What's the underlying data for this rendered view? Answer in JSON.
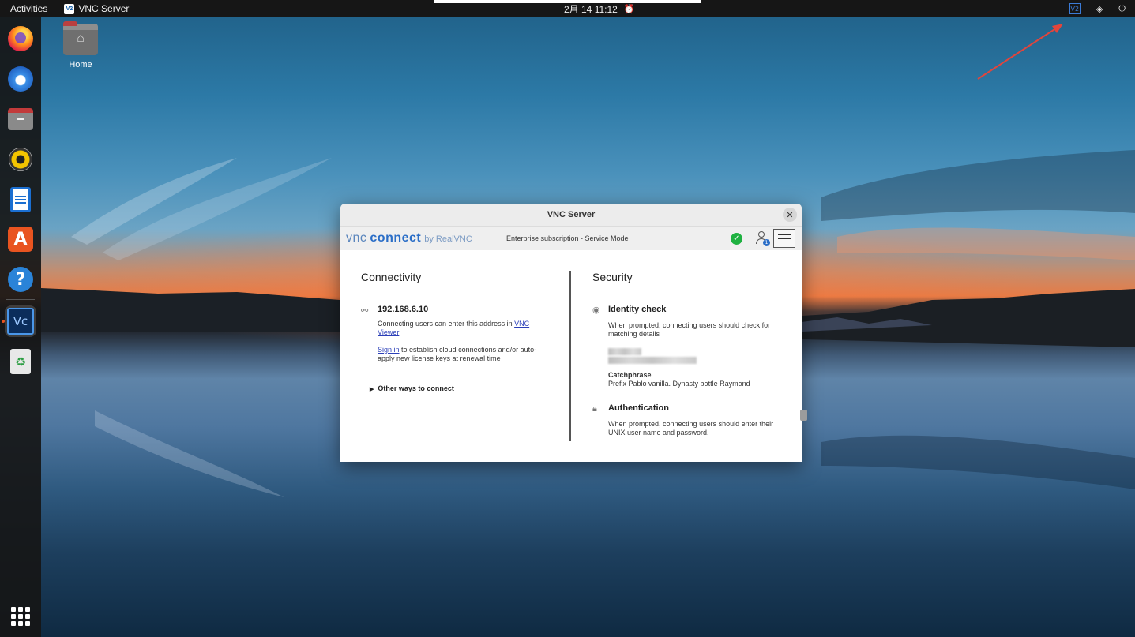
{
  "topbar": {
    "activities": "Activities",
    "app_name": "VNC Server",
    "app_icon_text": "V2",
    "clock": "2月 14  11:12",
    "tray_vnc_text": "V2"
  },
  "desktop": {
    "home_label": "Home"
  },
  "dock": {
    "items": [
      {
        "name": "firefox"
      },
      {
        "name": "thunderbird"
      },
      {
        "name": "files"
      },
      {
        "name": "rhythmbox"
      },
      {
        "name": "libreoffice-writer"
      },
      {
        "name": "ubuntu-software",
        "glyph": "A"
      },
      {
        "name": "help",
        "glyph": "?"
      },
      {
        "name": "vnc-server",
        "glyph": "Vc",
        "active": true
      },
      {
        "name": "trash",
        "glyph": "♻"
      }
    ]
  },
  "window": {
    "title": "VNC Server",
    "close_glyph": "✕",
    "brand_vnc": "vnc",
    "brand_connect": "connect",
    "brand_by": "by RealVNC",
    "subscription": "Enterprise subscription - Service Mode",
    "status_glyph": "✓",
    "users_badge": "1",
    "connectivity": {
      "title": "Connectivity",
      "ip": "192.168.6.10",
      "desc_before_link": "Connecting users can enter this address in ",
      "desc_link": "VNC Viewer",
      "signin_link": "Sign in",
      "signin_text": " to establish cloud connections and/or auto-apply new license keys at renewal time",
      "other_ways": "Other ways to connect"
    },
    "security": {
      "title": "Security",
      "identity_title": "Identity check",
      "identity_text": "When prompted, connecting users should check for matching details",
      "catchphrase_label": "Catchphrase",
      "catchphrase_value": "Prefix Pablo vanilla. Dynasty bottle Raymond",
      "auth_title": "Authentication",
      "auth_text": "When prompted, connecting users should enter their UNIX user name and password."
    }
  },
  "colors": {
    "accent_orange": "#e95420",
    "vnc_blue": "#2b6ec7",
    "status_green": "#1fb141",
    "annotation_red": "#e2453c"
  }
}
